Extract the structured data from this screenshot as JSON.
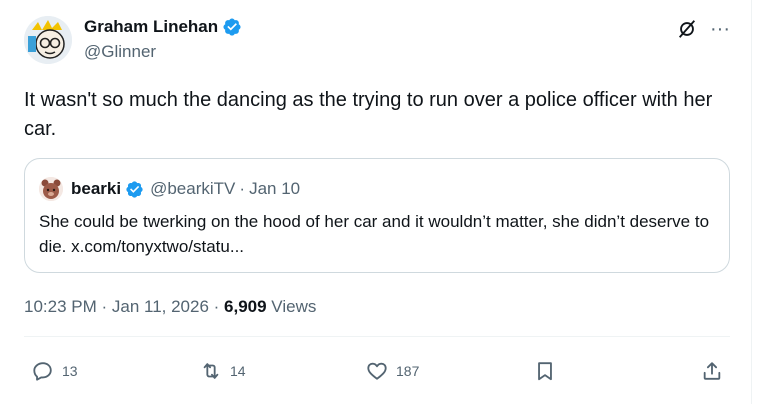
{
  "author": {
    "name": "Graham Linehan",
    "handle": "@Glinner"
  },
  "tweet": {
    "text": "It wasn't so much the dancing as the trying to run over a police officer with her car."
  },
  "quoted_tweet": {
    "name": "bearki",
    "handle": "@bearkiTV",
    "separator": "·",
    "date": "Jan 10",
    "text": "She could be twerking on the hood of her car and it wouldn’t matter, she didn’t deserve to die. x.com/tonyxtwo/statu..."
  },
  "meta": {
    "time": "10:23 PM",
    "dot1": " · ",
    "date": "Jan 11, 2026",
    "dot2": " · ",
    "views_count": "6,909",
    "views_label": " Views"
  },
  "actions": {
    "replies": "13",
    "reposts": "14",
    "likes": "187"
  },
  "header_icons": {
    "grok": "grok-icon",
    "more": "···"
  },
  "colors": {
    "text_primary": "#0f1419",
    "text_secondary": "#536471",
    "verified_blue": "#1d9bf0",
    "border": "#cfd9de"
  }
}
